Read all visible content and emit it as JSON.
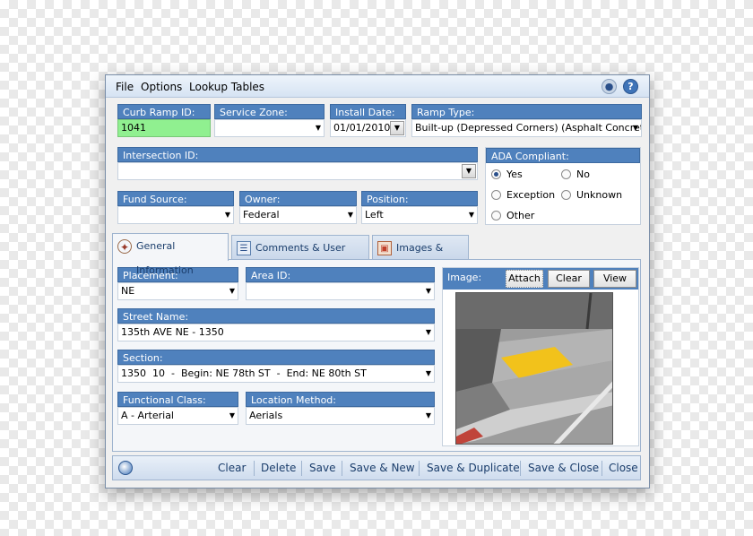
{
  "menu": {
    "file": "File",
    "options": "Options",
    "lookup_tables": "Lookup Tables"
  },
  "header_icons": [
    "chat-icon",
    "help-icon"
  ],
  "fields": {
    "curb_ramp_id": {
      "label": "Curb Ramp ID:",
      "value": "1041"
    },
    "service_zone": {
      "label": "Service Zone:",
      "value": ""
    },
    "install_date": {
      "label": "Install Date:",
      "value": "01/01/2010"
    },
    "ramp_type": {
      "label": "Ramp Type:",
      "value": "Built-up (Depressed Corners) (Asphalt Concrete)"
    },
    "intersection_id": {
      "label": "Intersection ID:",
      "value": ""
    },
    "fund_source": {
      "label": "Fund Source:",
      "value": ""
    },
    "owner": {
      "label": "Owner:",
      "value": "Federal"
    },
    "position": {
      "label": "Position:",
      "value": "Left"
    }
  },
  "ada": {
    "label": "ADA Compliant:",
    "options": [
      "Yes",
      "No",
      "Exception",
      "Unknown",
      "Other"
    ],
    "selected": "Yes"
  },
  "tabs": [
    {
      "label": "General Information",
      "icon": "compass-icon",
      "active": true
    },
    {
      "label": "Comments & User Fields",
      "icon": "notes-icon",
      "active": false
    },
    {
      "label": "Images & Docs",
      "icon": "images-icon",
      "active": false
    }
  ],
  "general": {
    "placement": {
      "label": "Placement:",
      "value": "NE"
    },
    "area_id": {
      "label": "Area ID:",
      "value": ""
    },
    "street_name": {
      "label": "Street Name:",
      "value": "135th AVE NE - 1350"
    },
    "section": {
      "label": "Section:",
      "value": "1350  10  -  Begin: NE 78th ST  -  End: NE 80th ST"
    },
    "functional_class": {
      "label": "Functional Class:",
      "value": "A - Arterial"
    },
    "location_method": {
      "label": "Location Method:",
      "value": "Aerials"
    }
  },
  "image_panel": {
    "label": "Image:",
    "attach": "Attach",
    "clear": "Clear",
    "view": "View"
  },
  "footer": {
    "clear": "Clear",
    "delete": "Delete",
    "save": "Save",
    "save_new": "Save & New",
    "save_duplicate": "Save & Duplicate",
    "save_close": "Save & Close",
    "close": "Close"
  },
  "colors": {
    "label_bg": "#4f81bd",
    "id_field": "#90f090",
    "ramp_tile": "#f2c21b",
    "curb_red": "#c0443a"
  }
}
